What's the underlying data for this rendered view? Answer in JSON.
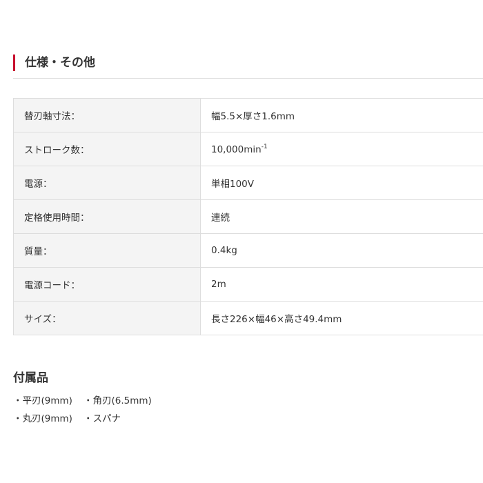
{
  "section": {
    "title": "仕様・その他"
  },
  "specs": [
    {
      "label": "替刃軸寸法：",
      "value": "幅5.5×厚さ1.6mm"
    },
    {
      "label": "ストローク数：",
      "value": "10,000min",
      "value_sup": "-1"
    },
    {
      "label": "電源：",
      "value": "単相100V"
    },
    {
      "label": "定格使用時間：",
      "value": "連続"
    },
    {
      "label": "質量：",
      "value": "0.4kg"
    },
    {
      "label": "電源コード：",
      "value": "2m"
    },
    {
      "label": "サイズ：",
      "value": "長さ226×幅46×高さ49.4mm"
    }
  ],
  "accessories": {
    "title": "付属品",
    "items": [
      "・平刃(9mm)",
      "・角刃(6.5mm)",
      "・丸刃(9mm)",
      "・スパナ"
    ]
  },
  "colors": {
    "accent": "#c8102e",
    "label_bg": "#f4f4f4",
    "border": "#dddddd",
    "text": "#333333"
  }
}
